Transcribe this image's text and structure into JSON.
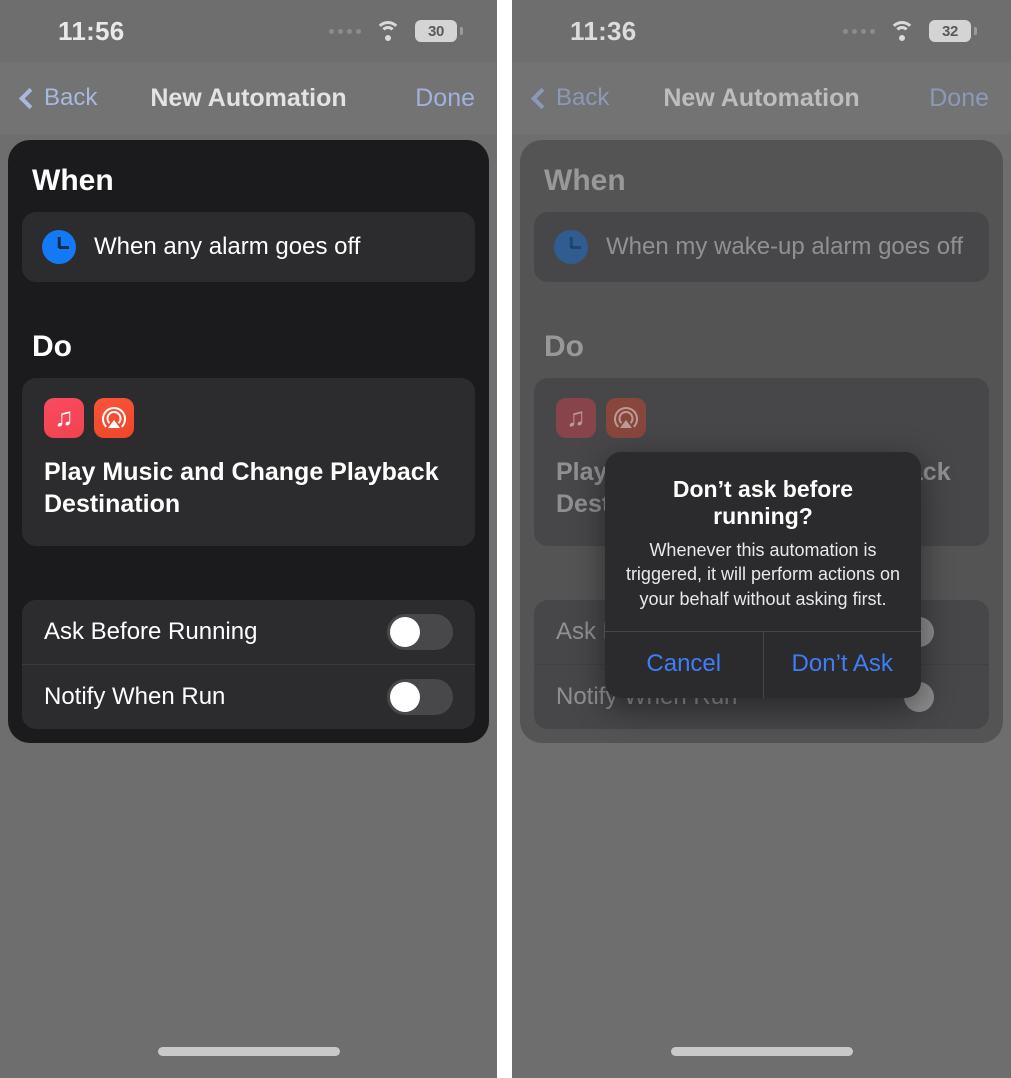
{
  "left_phone": {
    "status_bar": {
      "time": "11:56",
      "battery_level": "30",
      "wifi_icon": "wifi-icon",
      "signal_icon": "signal-dots-icon"
    },
    "nav_bar": {
      "back_label": "Back",
      "title": "New Automation",
      "done_label": "Done",
      "back_icon": "chevron-left-icon"
    },
    "when_section": {
      "heading": "When",
      "trigger_icon": "clock-icon",
      "trigger_label": "When any alarm goes off"
    },
    "do_section": {
      "heading": "Do",
      "app_icons": [
        "music-icon",
        "airplay-audio-icon"
      ],
      "music_glyph": "♫",
      "action_title": "Play Music and Change Playback Destination"
    },
    "options": [
      {
        "label": "Ask Before Running",
        "state": "off"
      },
      {
        "label": "Notify When Run",
        "state": "off"
      }
    ],
    "home_indicator": "home-indicator"
  },
  "right_phone": {
    "status_bar": {
      "time": "11:36",
      "battery_level": "32",
      "wifi_icon": "wifi-icon",
      "signal_icon": "signal-dots-icon"
    },
    "nav_bar": {
      "back_label": "Back",
      "title": "New Automation",
      "done_label": "Done",
      "back_icon": "chevron-left-icon"
    },
    "when_section": {
      "heading": "When",
      "trigger_icon": "clock-icon",
      "trigger_label": "When my wake-up alarm goes off"
    },
    "do_section": {
      "heading": "Do",
      "app_icons": [
        "music-icon",
        "airplay-audio-icon"
      ],
      "music_glyph": "♫",
      "action_title": "Play Music and Change Playback Destination"
    },
    "options": [
      {
        "label": "Ask Before Running",
        "state": "off"
      },
      {
        "label": "Notify When Run",
        "state": "off"
      }
    ],
    "alert": {
      "title": "Don’t ask before running?",
      "message": "Whenever this automation is triggered, it will perform actions on your behalf without asking first.",
      "cancel_label": "Cancel",
      "confirm_label": "Don’t Ask"
    },
    "home_indicator": "home-indicator"
  },
  "colors": {
    "accent_blue": "#3f7df6",
    "nav_tint": "#a9b8dd",
    "sheet_bg": "#1b1b1d",
    "card_bg": "#2c2c2e",
    "clock_icon": "#1479f5",
    "music_icon": "#f0434e",
    "airplay_icon": "#ee4629",
    "page_bg": "#6e6e6e"
  }
}
